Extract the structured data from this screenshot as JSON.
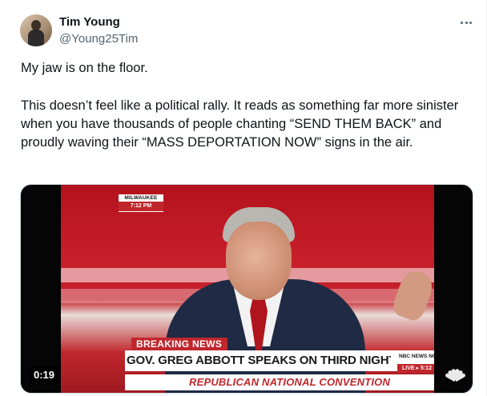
{
  "author": {
    "name": "Tim Young",
    "handle": "@Young25Tim"
  },
  "tweet": {
    "paragraph1": "My jaw is on the floor.",
    "paragraph2": "This doesn’t feel like a political rally. It reads as something far more sinister when you have thousands of people chanting “SEND THEM BACK” and proudly waving their “MASS DEPORTATION NOW” signs in the air."
  },
  "video": {
    "duration": "0:19",
    "location": "MILWAUKEE",
    "time": "7:12 PM",
    "breaking_label": "BREAKING NEWS",
    "headline": "GOV. GREG ABBOTT SPEAKS ON THIRD NIGHT OF RNC",
    "network": "NBC NEWS NOW.",
    "live": "LIVE  ▸  5:12",
    "convention": "REPUBLICAN NATIONAL CONVENTION"
  },
  "colors": {
    "text": "#0f1419",
    "secondary": "#536471",
    "news_red": "#c0272d"
  },
  "icons": {
    "more": "more-horizontal-icon",
    "logo": "nbc-peacock-icon"
  }
}
